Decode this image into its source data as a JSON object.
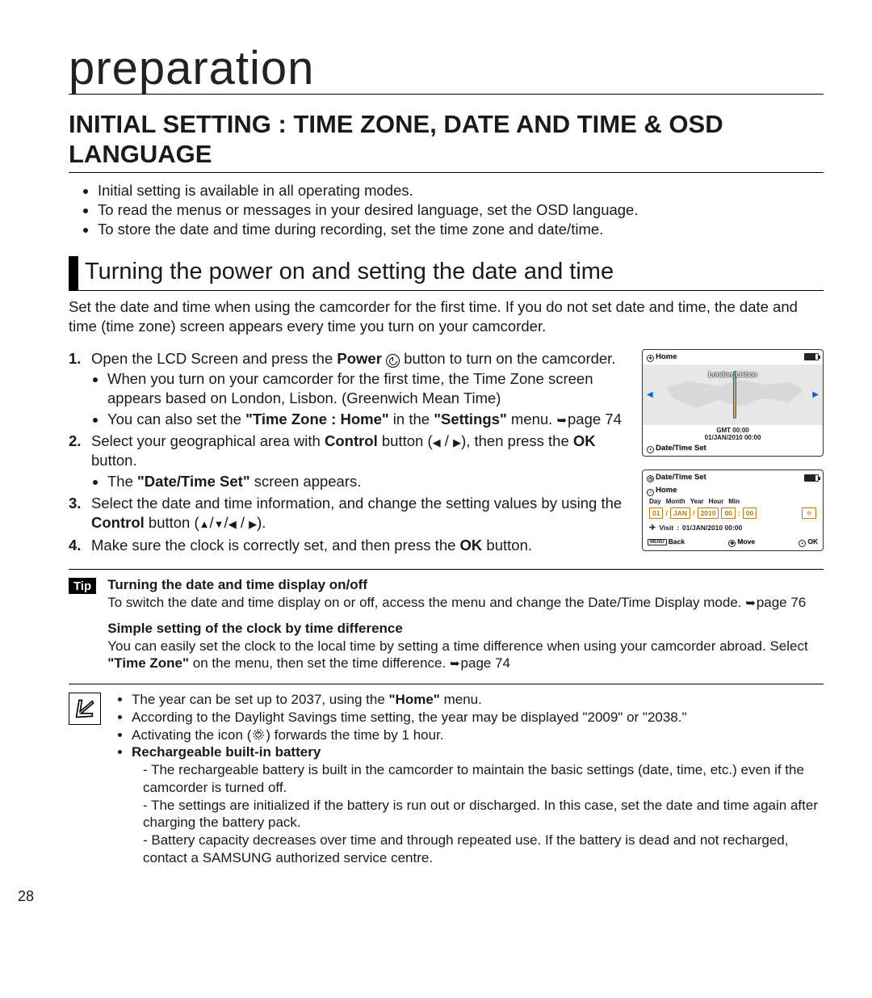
{
  "page_number": "28",
  "chapter": "preparation",
  "heading": "INITIAL SETTING : TIME ZONE, DATE AND TIME & OSD LANGUAGE",
  "top_bullets": [
    "Initial setting is available in all operating modes.",
    "To read the menus or messages in your desired language, set the OSD language.",
    "To store the date and time during recording, set the time zone and date/time."
  ],
  "sub": {
    "title": "Turning the power on and setting the date and time",
    "intro": "Set the date and time when using the camcorder for the first time. If you do not set date and time, the date and time (time zone) screen appears every time you turn on your camcorder."
  },
  "steps": {
    "s1_a": "Open the LCD Screen and press the ",
    "s1_power": "Power",
    "s1_b": " button to turn on the camcorder.",
    "s1_sub1": "When you turn on your camcorder for the first time, the Time Zone screen appears based on London, Lisbon. (Greenwich Mean Time)",
    "s1_sub2_a": "You can also set the ",
    "s1_sub2_b": "\"Time Zone : Home\"",
    "s1_sub2_c": " in the ",
    "s1_sub2_d": "\"Settings\"",
    "s1_sub2_e": " menu. ",
    "s1_sub2_page": "page 74",
    "s2_a": "Select your geographical area with ",
    "s2_ctrl": "Control",
    "s2_b": " button (",
    "s2_c": "), then press the ",
    "s2_ok": "OK",
    "s2_d": " button.",
    "s2_sub_a": "The ",
    "s2_sub_b": "\"Date/Time Set\"",
    "s2_sub_c": " screen appears.",
    "s3_a": "Select the date and time information, and change the setting values by using the ",
    "s3_ctrl": "Control",
    "s3_b": " button (",
    "s3_c": ").",
    "s4_a": "Make sure the clock is correctly set, and then press the ",
    "s4_ok": "OK",
    "s4_b": " button."
  },
  "screen1": {
    "title": "Home",
    "city": "London, Lisbon",
    "gmt": "GMT 00:00",
    "date": "01/JAN/2010 00:00",
    "bottom": "Date/Time Set"
  },
  "screen2": {
    "title": "Date/Time Set",
    "sub": "Home",
    "labels": {
      "day": "Day",
      "month": "Month",
      "year": "Year",
      "hour": "Hour",
      "min": "Min"
    },
    "fields": {
      "day": "01",
      "month": "JAN",
      "year": "2010",
      "hour": "00",
      "min": "00"
    },
    "visit_label": "Visit",
    "visit_value": "01/JAN/2010 00:00",
    "actions": {
      "back": "Back",
      "move": "Move",
      "ok": "OK"
    },
    "menu": "MENU"
  },
  "tip": {
    "badge": "Tip",
    "h1": "Turning the date and time display on/off",
    "p1_a": "To switch the date and time display on or off, access the menu and change the Date/Time Display mode. ",
    "p1_page": "page 76",
    "h2": "Simple setting of the clock by time difference",
    "p2_a": "You can easily set the clock to the local time by setting a time difference when using your camcorder abroad. Select ",
    "p2_b": "\"Time Zone\"",
    "p2_c": " on the menu, then set the time difference. ",
    "p2_page": "page 74"
  },
  "notes": {
    "n1_a": "The year can be set up to 2037, using the ",
    "n1_b": "\"Home\"",
    "n1_c": " menu.",
    "n2": "According to the Daylight Savings time setting, the year may be displayed \"2009\" or \"2038.\"",
    "n3_a": "Activating the icon (",
    "n3_b": ") forwards the time by 1 hour.",
    "n4_h": "Rechargeable built-in battery",
    "n4_d1": "The rechargeable battery is built in the camcorder to maintain the basic settings (date, time, etc.) even if the camcorder is turned off.",
    "n4_d2": "The settings are initialized if the battery is run out or discharged. In this case, set the date and time again after charging the battery pack.",
    "n4_d3": "Battery capacity decreases over time and through repeated use. If the battery is dead and not recharged, contact a SAMSUNG authorized service centre."
  }
}
